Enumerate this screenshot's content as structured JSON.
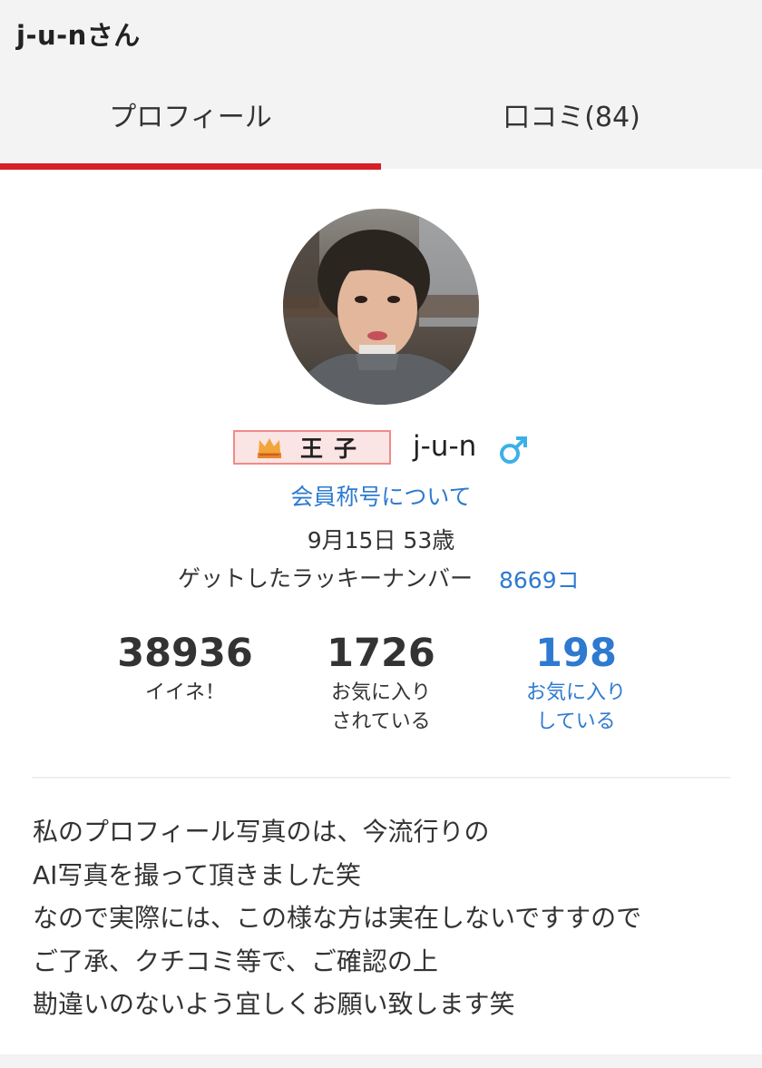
{
  "page": {
    "title": "j-u-nさん"
  },
  "tabs": [
    {
      "label": "プロフィール",
      "active": true
    },
    {
      "label": "口コミ(84)",
      "active": false
    }
  ],
  "colors": {
    "accent_red": "#d61f26",
    "link_blue": "#2e7ad0",
    "male_blue": "#3cb0e8"
  },
  "profile": {
    "rank": {
      "icon": "crown-icon",
      "label": "王子"
    },
    "name": "j-u-n",
    "gender_icon": "male-symbol-icon",
    "title_link": "会員称号について",
    "birthday": "9月15日 53歳",
    "lucky_label": "ゲットしたラッキーナンバー",
    "lucky_value": "8669コ"
  },
  "stats": {
    "likes": {
      "value": "38936",
      "label": "イイネ！"
    },
    "favorited": {
      "value": "1726",
      "label_line1": "お気に入り",
      "label_line2": "されている"
    },
    "favoriting": {
      "value": "198",
      "label_line1": "お気に入り",
      "label_line2": "している"
    }
  },
  "bio": [
    "私のプロフィール写真のは、今流行りの",
    "AI写真を撮って頂きました笑",
    "なので実際には、この様な方は実在しないですすので",
    "ご了承、クチコミ等で、ご確認の上",
    "勘違いのないよう宜しくお願い致します笑"
  ]
}
